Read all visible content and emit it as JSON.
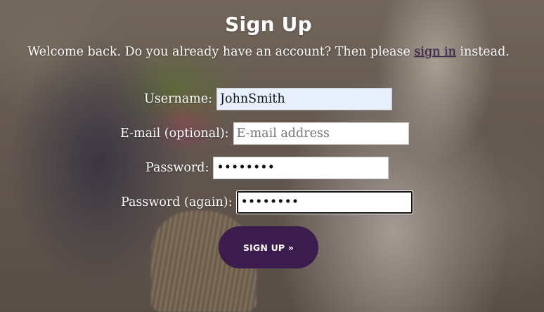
{
  "page": {
    "title": "Sign Up",
    "welcome_prefix": "Welcome back. Do you already have an account? Then please ",
    "welcome_link": "sign in",
    "welcome_suffix": " instead."
  },
  "form": {
    "username": {
      "label": "Username:",
      "value": "JohnSmith",
      "placeholder": ""
    },
    "email": {
      "label": "E-mail (optional):",
      "value": "",
      "placeholder": "E-mail address"
    },
    "password": {
      "label": "Password:",
      "value": "••••••••"
    },
    "password_again": {
      "label": "Password (again):",
      "value": "••••••••"
    },
    "submit_label": "SIGN UP »"
  },
  "colors": {
    "accent": "#3b1c4d",
    "link": "#3c1f4f",
    "autofill_bg": "#e8f0fe"
  }
}
